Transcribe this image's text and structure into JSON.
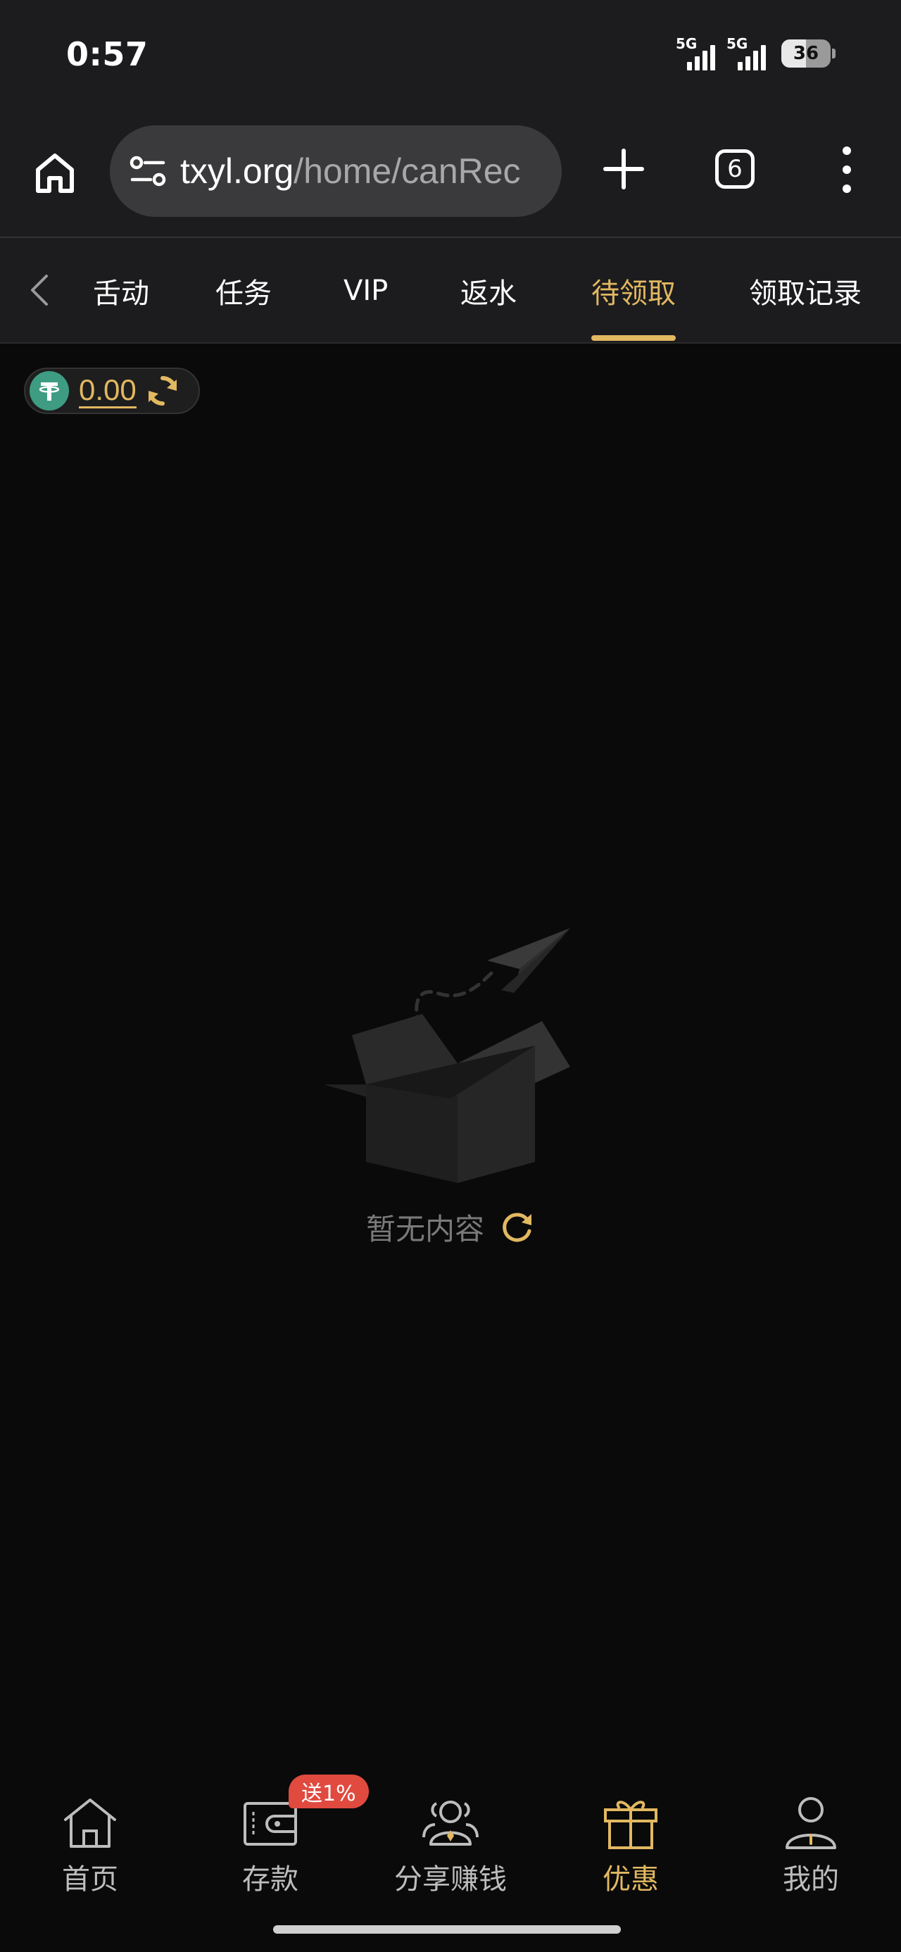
{
  "status_bar": {
    "time": "0:57",
    "network_1": "5G",
    "network_2": "5G",
    "battery": "36"
  },
  "browser": {
    "url_host": "txyl.org",
    "url_path": "/home/canRec",
    "tab_count": "6"
  },
  "tabs": [
    {
      "label": "活动",
      "visible_text": "舌动"
    },
    {
      "label": "任务"
    },
    {
      "label": "VIP"
    },
    {
      "label": "返水"
    },
    {
      "label": "待领取",
      "active": true
    },
    {
      "label": "领取记录"
    }
  ],
  "balance": {
    "value": "0.00",
    "currency_icon": "usdt-tether-icon"
  },
  "empty_state": {
    "text": "暂无内容",
    "illustration": "empty-box-with-paper-plane"
  },
  "bottom_nav": [
    {
      "label": "首页",
      "icon": "home-icon"
    },
    {
      "label": "存款",
      "icon": "wallet-icon",
      "badge": "送1%"
    },
    {
      "label": "分享赚钱",
      "icon": "share-people-icon"
    },
    {
      "label": "优惠",
      "icon": "gift-icon",
      "active": true
    },
    {
      "label": "我的",
      "icon": "user-icon"
    }
  ],
  "colors": {
    "accent": "#e2b861",
    "background": "#0a0a0a",
    "header": "#1c1c1e",
    "badge": "#e04a3f",
    "usdt": "#3d9c82"
  }
}
